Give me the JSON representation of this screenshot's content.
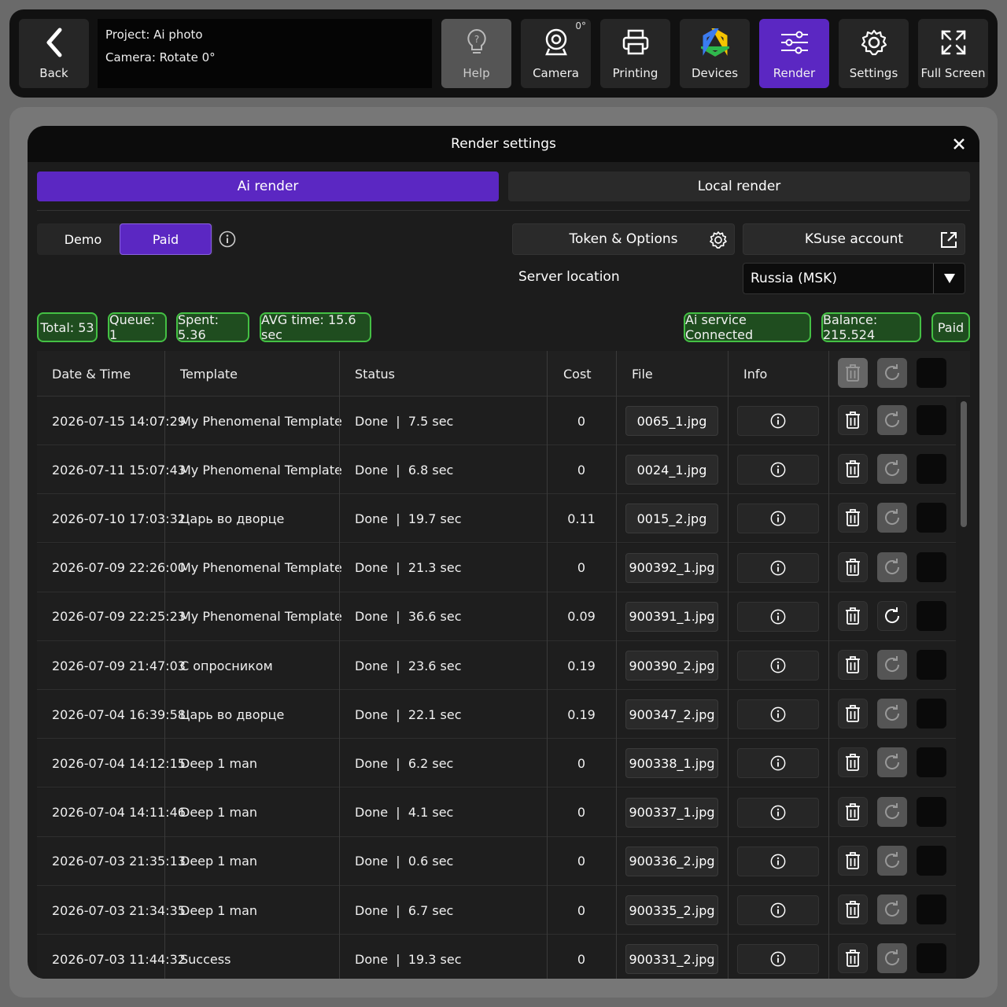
{
  "topbar": {
    "back_label": "Back",
    "project_line": "Project: Ai photo",
    "camera_line": "Camera: Rotate 0°",
    "camera_angle": "0°",
    "buttons": [
      {
        "label": "Help",
        "icon": "help-bulb-icon"
      },
      {
        "label": "Camera",
        "icon": "webcam-icon"
      },
      {
        "label": "Printing",
        "icon": "printer-icon"
      },
      {
        "label": "Devices",
        "icon": "devices-ring-icon"
      },
      {
        "label": "Render",
        "icon": "sliders-icon"
      },
      {
        "label": "Settings",
        "icon": "gear-icon"
      },
      {
        "label": "Full Screen",
        "icon": "fullscreen-icon"
      }
    ]
  },
  "modal": {
    "title": "Render settings",
    "tabs": {
      "ai": "Ai render",
      "local": "Local render"
    },
    "mode": {
      "demo": "Demo",
      "paid": "Paid"
    },
    "token_options": "Token & Options",
    "ksuse_account": "KSuse account",
    "server_location_label": "Server location",
    "server_location_value": "Russia (MSK)",
    "stats": {
      "total": "Total: 53",
      "queue": "Queue: 1",
      "spent": "Spent: 5.36",
      "avg": "AVG time: 15.6 sec",
      "service": "Ai service Connected",
      "balance": "Balance: 215.524",
      "paid": "Paid"
    },
    "colors": {
      "accent": "#5b27c2",
      "status_green": "#44c044"
    }
  },
  "table": {
    "headers": {
      "datetime": "Date & Time",
      "template": "Template",
      "status": "Status",
      "cost": "Cost",
      "file": "File",
      "info": "Info"
    },
    "rows": [
      {
        "datetime": "2026-07-15 14:07:29",
        "template": "My Phenomenal Template",
        "status": "Done  |  7.5 sec",
        "cost": "0",
        "file": "0065_1.jpg"
      },
      {
        "datetime": "2026-07-11 15:07:43",
        "template": "My Phenomenal Template",
        "status": "Done  |  6.8 sec",
        "cost": "0",
        "file": "0024_1.jpg"
      },
      {
        "datetime": "2026-07-10 17:03:32",
        "template": "Царь во дворце",
        "status": "Done  |  19.7 sec",
        "cost": "0.11",
        "file": "0015_2.jpg"
      },
      {
        "datetime": "2026-07-09 22:26:00",
        "template": "My Phenomenal Template",
        "status": "Done  |  21.3 sec",
        "cost": "0",
        "file": "900392_1.jpg"
      },
      {
        "datetime": "2026-07-09 22:25:23",
        "template": "My Phenomenal Template",
        "status": "Done  |  36.6 sec",
        "cost": "0.09",
        "file": "900391_1.jpg"
      },
      {
        "datetime": "2026-07-09 21:47:03",
        "template": "С опросником",
        "status": "Done  |  23.6 sec",
        "cost": "0.19",
        "file": "900390_2.jpg"
      },
      {
        "datetime": "2026-07-04 16:39:58",
        "template": "Царь во дворце",
        "status": "Done  |  22.1 sec",
        "cost": "0.19",
        "file": "900347_2.jpg"
      },
      {
        "datetime": "2026-07-04 14:12:15",
        "template": "Deep 1 man",
        "status": "Done  |  6.2 sec",
        "cost": "0",
        "file": "900338_1.jpg"
      },
      {
        "datetime": "2026-07-04 14:11:46",
        "template": "Deep 1 man",
        "status": "Done  |  4.1 sec",
        "cost": "0",
        "file": "900337_1.jpg"
      },
      {
        "datetime": "2026-07-03 21:35:13",
        "template": "Deep 1 man",
        "status": "Done  |  0.6 sec",
        "cost": "0",
        "file": "900336_2.jpg"
      },
      {
        "datetime": "2026-07-03 21:34:35",
        "template": "Deep 1 man",
        "status": "Done  |  6.7 sec",
        "cost": "0",
        "file": "900335_2.jpg"
      },
      {
        "datetime": "2026-07-03 11:44:32",
        "template": "Success",
        "status": "Done  |  19.3 sec",
        "cost": "0",
        "file": "900331_2.jpg"
      }
    ]
  }
}
